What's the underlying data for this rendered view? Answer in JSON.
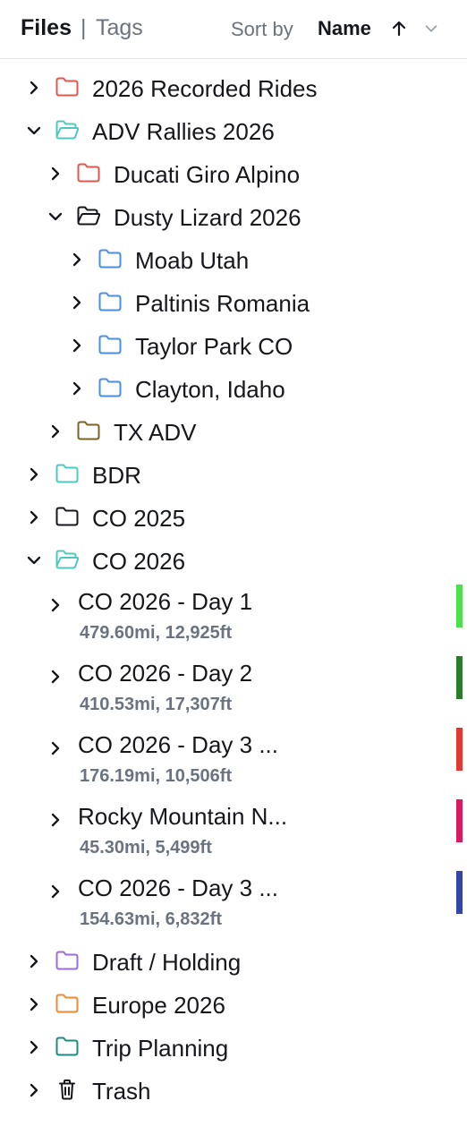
{
  "header": {
    "files_label": "Files",
    "separator": "|",
    "tags_label": "Tags",
    "sort_by_label": "Sort by",
    "sort_value": "Name",
    "sort_direction": "ascending"
  },
  "tree": [
    {
      "label": "2026 Recorded Rides",
      "expanded": false,
      "folder_color": "#e0574f"
    },
    {
      "label": "ADV Rallies 2026",
      "expanded": true,
      "folder_color": "#4cc9c0"
    },
    {
      "label": "Ducati Giro Alpino",
      "expanded": false,
      "folder_color": "#e0574f"
    },
    {
      "label": "Dusty Lizard 2026",
      "expanded": true,
      "folder_color": "#15171c"
    },
    {
      "label": "Moab Utah",
      "expanded": false,
      "folder_color": "#4a8fe0"
    },
    {
      "label": "Paltinis Romania",
      "expanded": false,
      "folder_color": "#4a8fe0"
    },
    {
      "label": "Taylor Park CO",
      "expanded": false,
      "folder_color": "#4a8fe0"
    },
    {
      "label": "Clayton, Idaho",
      "expanded": false,
      "folder_color": "#4a8fe0"
    },
    {
      "label": "TX ADV",
      "expanded": false,
      "folder_color": "#7a6326"
    },
    {
      "label": "BDR",
      "expanded": false,
      "folder_color": "#4cc9c0"
    },
    {
      "label": "CO 2025",
      "expanded": false,
      "folder_color": "#15171c"
    },
    {
      "label": "CO 2026",
      "expanded": true,
      "folder_color": "#4cc9c0"
    }
  ],
  "tracks": [
    {
      "name": "CO 2026 - Day 1",
      "stats": "479.60mi, 12,925ft",
      "color": "#4ee04c"
    },
    {
      "name": "CO 2026 - Day 2",
      "stats": "410.53mi, 17,307ft",
      "color": "#2c7a2c"
    },
    {
      "name": "CO 2026 - Day 3 ...",
      "stats": "176.19mi, 10,506ft",
      "color": "#e03a32"
    },
    {
      "name": "Rocky Mountain N...",
      "stats": "45.30mi, 5,499ft",
      "color": "#d81b60"
    },
    {
      "name": "CO 2026 - Day 3 ...",
      "stats": "154.63mi, 6,832ft",
      "color": "#3345a6"
    }
  ],
  "tree_after": [
    {
      "label": "Draft / Holding",
      "expanded": false,
      "folder_color": "#9b6ce0"
    },
    {
      "label": "Europe 2026",
      "expanded": false,
      "folder_color": "#ee8a33"
    },
    {
      "label": "Trip Planning",
      "expanded": false,
      "folder_color": "#1f8a7e"
    },
    {
      "label": "Trash",
      "expanded": false,
      "icon": "trash-icon",
      "folder_color": "#15171c"
    }
  ]
}
